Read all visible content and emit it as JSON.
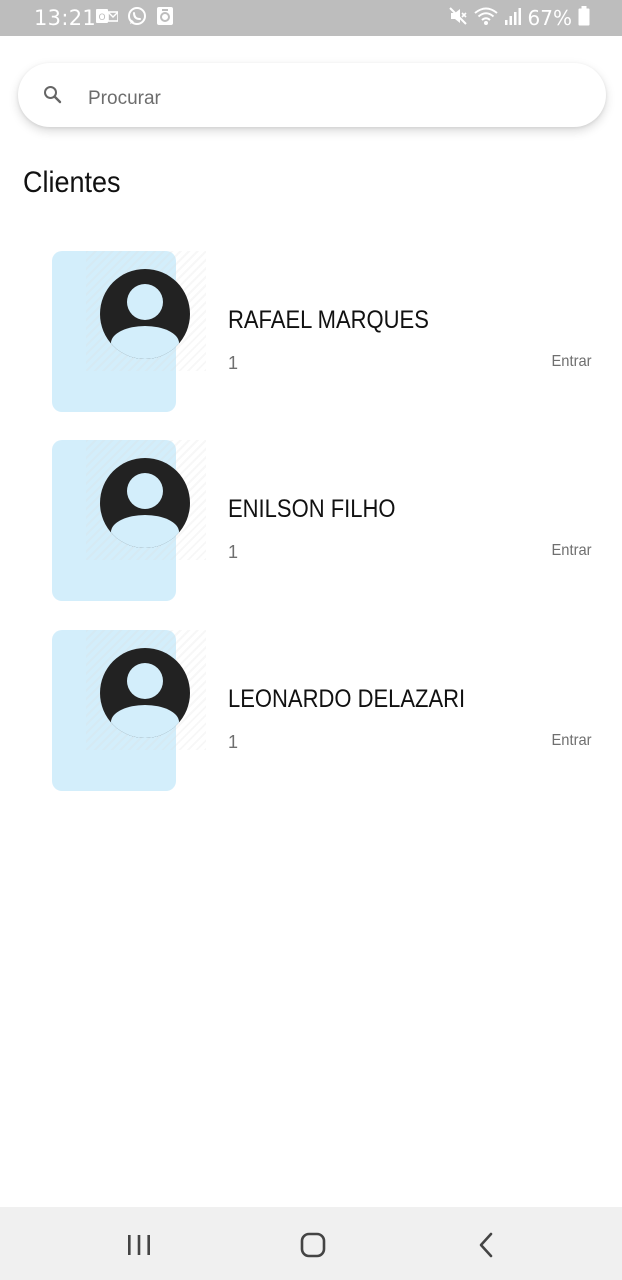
{
  "status_bar": {
    "time": "13:21",
    "battery": "67%",
    "left_icons": [
      "outlook-icon",
      "whatsapp-icon",
      "clip-icon"
    ],
    "right_icons": [
      "mute-icon",
      "wifi-icon",
      "signal-icon",
      "battery-icon"
    ]
  },
  "search": {
    "placeholder": "Procurar",
    "value": ""
  },
  "page_title": "Clientes",
  "clients": [
    {
      "name": "RAFAEL MARQUES",
      "count": "1",
      "action": "Entrar"
    },
    {
      "name": "ENILSON FILHO",
      "count": "1",
      "action": "Entrar"
    },
    {
      "name": "LEONARDO DELAZARI",
      "count": "1",
      "action": "Entrar"
    }
  ],
  "nav_bar": {
    "buttons": [
      "recents-icon",
      "home-icon",
      "back-icon"
    ]
  },
  "colors": {
    "status_bar_bg": "#bdbdbd",
    "card_bg": "#d3eefb",
    "avatar": "#222222",
    "nav_bg": "#f0f0f0"
  }
}
